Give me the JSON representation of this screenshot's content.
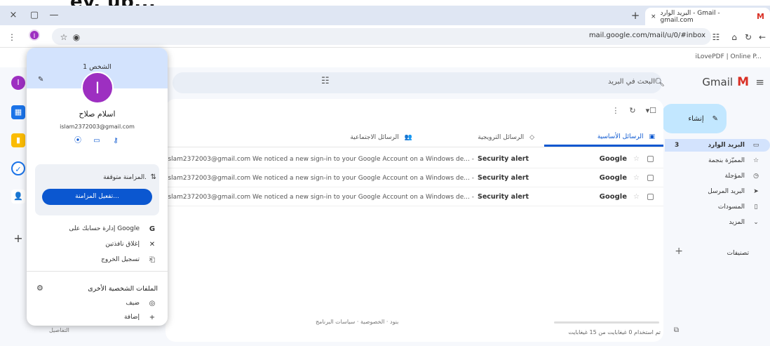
{
  "banner_text": "ey. up...",
  "window": {
    "close": "×",
    "restore": "▢",
    "minimize": "—"
  },
  "tab": {
    "title": "البريد الوارد - Gmail - gmail.com",
    "close": "×",
    "new_tab": "+"
  },
  "url": "mail.google.com/mail/u/0/#inbox",
  "bookmark": "iLovePDF | Online P...",
  "profile_initial": "I",
  "gmail": {
    "brand": "Gmail",
    "search_placeholder": "البحث في البريد",
    "compose": "إنشاء",
    "nav": [
      {
        "label": "البريد الوارد",
        "icon": "inbox-icon",
        "glyph": "▭",
        "count": "3"
      },
      {
        "label": "المميّزة بنجمة",
        "icon": "star-icon",
        "glyph": "☆"
      },
      {
        "label": "المؤجلة",
        "icon": "clock-icon",
        "glyph": "◷"
      },
      {
        "label": "البريد المرسل",
        "icon": "send-icon",
        "glyph": "➤"
      },
      {
        "label": "المسودات",
        "icon": "draft-icon",
        "glyph": "▯"
      },
      {
        "label": "المزيد",
        "icon": "chevron-down-icon",
        "glyph": "⌄"
      }
    ],
    "labels_heading": "تصنيفات",
    "inbox_tabs": [
      {
        "label": "الرسائل الأساسية",
        "glyph": "▣"
      },
      {
        "label": "الرسائل الترويجية",
        "glyph": "◇"
      },
      {
        "label": "الرسائل الاجتماعية",
        "glyph": "👥"
      }
    ],
    "emails": [
      {
        "sender": "Google",
        "subject": "Security alert",
        "preview": "ws islam2372003@gmail.com We noticed a new sign-in to your Google Account on a Windows de... -"
      },
      {
        "sender": "Google",
        "subject": "Security alert",
        "preview": "ws islam2372003@gmail.com We noticed a new sign-in to your Google Account on a Windows de... -"
      },
      {
        "sender": "Google",
        "subject": "Security alert",
        "preview": "ws islam2372003@gmail.com We noticed a new sign-in to your Google Account on a Windows de... -"
      }
    ],
    "storage": "تم استخدام 0 غيغابايت من 15 غيغابايت",
    "footer": "بنود · الخصوصية · سياسات البرنامج",
    "details": "التفاصيل"
  },
  "profile_menu": {
    "title": "الشخص 1",
    "avatar": "I",
    "name": "اسلام صلاح",
    "email": "islam2372003@gmail.com",
    "sync_status": "المزامنة متوقفة.",
    "sync_button": "تفعيل المزامنة...",
    "items": [
      {
        "label": "إدارة حسابك على Google",
        "glyph": "G",
        "icon": "google-icon"
      },
      {
        "label": "إغلاق نافذتين",
        "glyph": "✕",
        "icon": "close-icon"
      },
      {
        "label": "تسجيل الخروج",
        "glyph": "⎗",
        "icon": "sign-out-icon"
      }
    ],
    "other_profiles": "الملفات الشخصية الأخرى",
    "guest": "ضيف",
    "add": "إضافة"
  }
}
